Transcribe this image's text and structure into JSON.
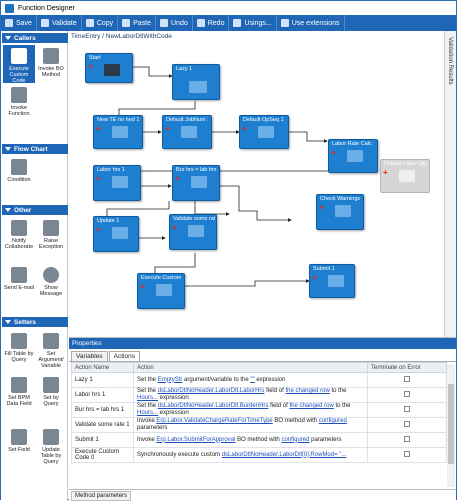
{
  "window": {
    "title": "Function Designer"
  },
  "toolbar": {
    "save": "Save",
    "validate": "Validate",
    "copy": "Copy",
    "paste": "Paste",
    "undo": "Undo",
    "redo": "Redo",
    "usings": "Usings...",
    "extensions": "Use extensions"
  },
  "palette": {
    "callers_header": "Callers",
    "callers": [
      {
        "label": "Execute Custom Code"
      },
      {
        "label": "Invoke BO Method"
      },
      {
        "label": "Invoke Function"
      }
    ],
    "flowchart_header": "Flow Chart",
    "flowchart": [
      {
        "label": "Condition"
      }
    ],
    "other_header": "Other",
    "other": [
      {
        "label": "Notify Collaborate"
      },
      {
        "label": "Raise Exception"
      },
      {
        "label": "Send E-mail"
      },
      {
        "label": "Show Message"
      }
    ],
    "setters_header": "Setters",
    "setters": [
      {
        "label": "Fill Table by Query"
      },
      {
        "label": "Set Argument/ Variable"
      },
      {
        "label": "Set BPM Data Field"
      },
      {
        "label": "Set by Query"
      },
      {
        "label": "Set Field"
      },
      {
        "label": "Update Table by Query"
      }
    ]
  },
  "canvas": {
    "breadcrumb": "TimeEntry / NewLaborDtlWithCode",
    "nodes": [
      {
        "title": "Start"
      },
      {
        "title": "Lazy 1"
      },
      {
        "title": "New TE no hed 1"
      },
      {
        "title": "Default JobNum 1"
      },
      {
        "title": "Default OpSeq 1"
      },
      {
        "title": "Labor Rate Calc 1"
      },
      {
        "title": "Default Labor Qty"
      },
      {
        "title": "Labor hrs 1"
      },
      {
        "title": "Bur hrs = lab hrs 1"
      },
      {
        "title": "Check Warnings 1"
      },
      {
        "title": "Update 1"
      },
      {
        "title": "Validate some rate"
      },
      {
        "title": "Execute Custom Co"
      },
      {
        "title": "Submit 1"
      }
    ]
  },
  "right_tab": "Validation Results",
  "properties": {
    "header": "Properties",
    "tabs": [
      "Variables",
      "Actions"
    ],
    "columns": {
      "name": "Action Name",
      "action": "Action",
      "terminate": "Terminate on Error"
    },
    "rows": [
      {
        "name": "Lazy 1",
        "p1": "Set the ",
        "l1": "EmptyStr",
        "p2": " argument/variable to the ",
        "l2": "\"\"",
        "p3": " expression",
        "l3": "",
        "p4": ""
      },
      {
        "name": "Labor hrs 1",
        "p1": "Set the ",
        "l1": "dsLaborDtlNoHeader.LaborDtl.LaborHrs",
        "p2": " field of ",
        "l2": "the changed row",
        "p3": " to the ",
        "l3": "Hours...",
        "p4": " expression"
      },
      {
        "name": "Bur hrs = lab hrs 1",
        "p1": "Set the ",
        "l1": "dsLaborDtlNoHeader.LaborDtl.BurdenHrs",
        "p2": " field of ",
        "l2": "the changed row",
        "p3": " to the ",
        "l3": "Hours...",
        "p4": " expression"
      },
      {
        "name": "Validate some rate 1",
        "p1": "Invoke ",
        "l1": "Erp.Labor.ValidateChargeRateForTimeType",
        "p2": " BO method with ",
        "l2": "configured",
        "p3": " parameters",
        "l3": "",
        "p4": ""
      },
      {
        "name": "Submit 1",
        "p1": "Invoke ",
        "l1": "Erp.Labor.SubmitForApproval",
        "p2": " BO method with ",
        "l2": "configured",
        "p3": " parameters",
        "l3": "",
        "p4": ""
      },
      {
        "name": "Execute Custom Code 0",
        "p1": "Synchronously execute custom ",
        "l1": "dsLaborDtlNoHeader.LaborDtl[0].RowMod= \"...",
        "p2": "",
        "l2": "",
        "p3": "",
        "l3": "",
        "p4": ""
      }
    ]
  },
  "bottom_tab": "Method parameters",
  "colors": {
    "accent": "#1f66b6",
    "node": "#1e7fd1",
    "disabled_node": "#d6d6d6",
    "link": "#1f4fbf"
  }
}
